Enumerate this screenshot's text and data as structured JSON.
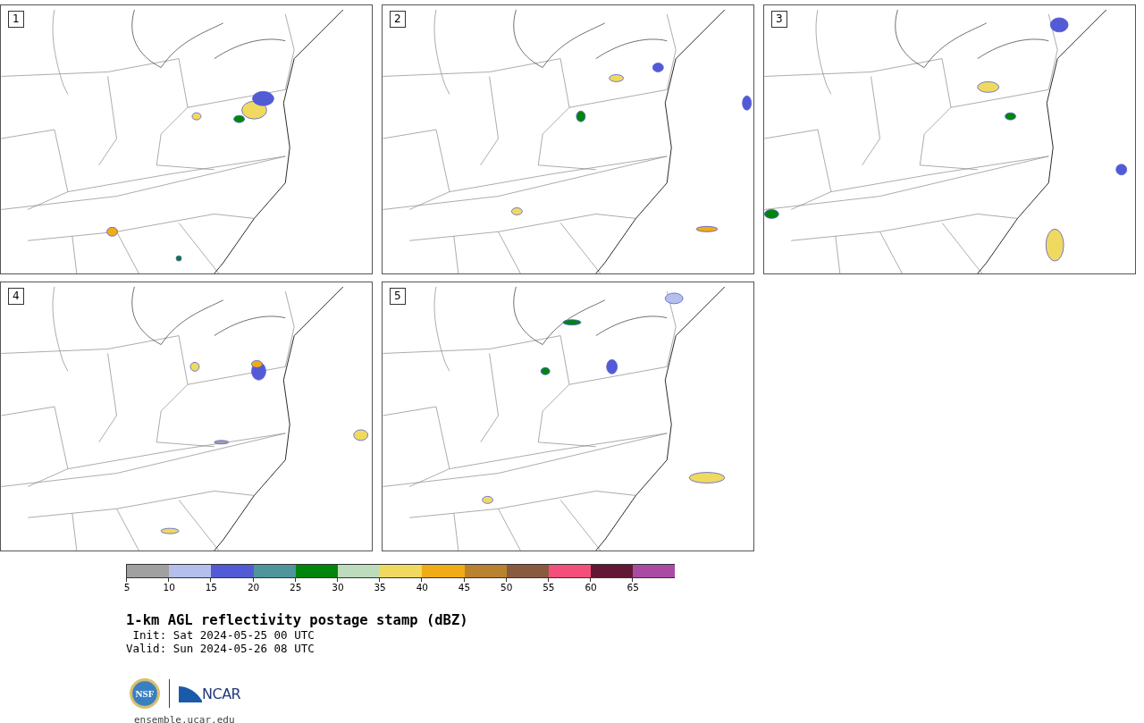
{
  "panels": [
    {
      "label": "1"
    },
    {
      "label": "2"
    },
    {
      "label": "3"
    },
    {
      "label": "4"
    },
    {
      "label": "5"
    }
  ],
  "colorbar": {
    "bins": [
      {
        "color": "#a0a0a0"
      },
      {
        "color": "#b4bfec"
      },
      {
        "color": "#535ad6"
      },
      {
        "color": "#4f959b"
      },
      {
        "color": "#00860a"
      },
      {
        "color": "#bddcbc"
      },
      {
        "color": "#efda5f"
      },
      {
        "color": "#efac14"
      },
      {
        "color": "#b9822e"
      },
      {
        "color": "#8a5a3f"
      },
      {
        "color": "#f44f7b"
      },
      {
        "color": "#621834"
      },
      {
        "color": "#ab4aa3"
      }
    ],
    "ticks": [
      "5",
      "10",
      "15",
      "20",
      "25",
      "30",
      "35",
      "40",
      "45",
      "50",
      "55",
      "60",
      "65"
    ]
  },
  "title": "1-km AGL reflectivity postage stamp (dBZ)",
  "init": " Init: Sat 2024-05-25 00 UTC",
  "valid": "Valid: Sun 2024-05-26 08 UTC",
  "logo": {
    "nsf": "NSF",
    "ncar": "NCAR"
  },
  "footer_link": "ensemble.ucar.edu"
}
